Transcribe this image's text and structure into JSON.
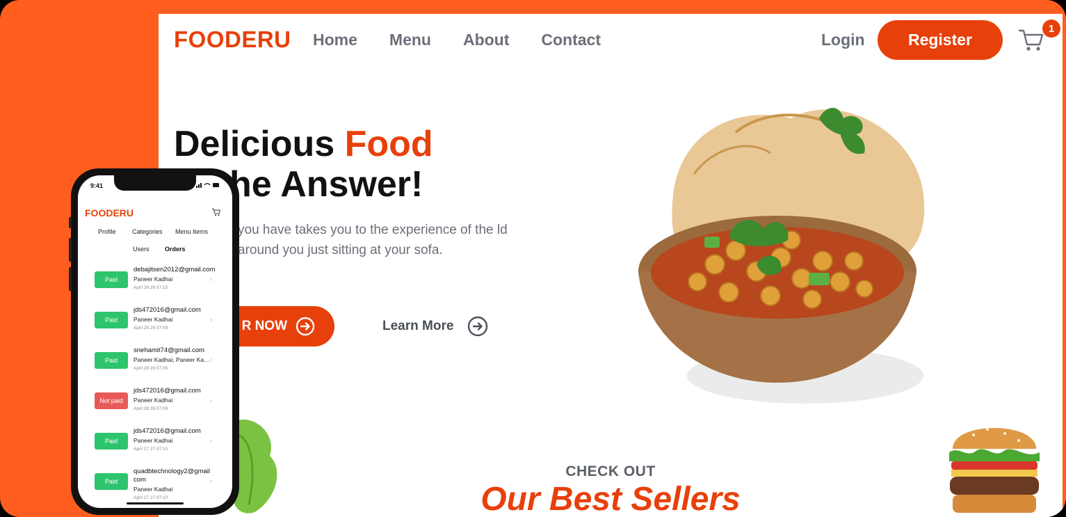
{
  "website": {
    "brand": "FOODERU",
    "nav": [
      "Home",
      "Menu",
      "About",
      "Contact"
    ],
    "login": "Login",
    "register": "Register",
    "cart_count": "1",
    "hero": {
      "title_part1": "Delicious ",
      "title_accent": "Food",
      "title_line2": "he Answer!",
      "description": "you have takes you to the experience of the ld around you just sitting at your sofa.",
      "order_button": "R NOW",
      "learn_more": "Learn More"
    },
    "section_kicker": "CHECK OUT",
    "section_title": "Our Best Sellers"
  },
  "phone": {
    "time": "9:41",
    "brand": "FOODERU",
    "tabs": [
      "Profile",
      "Categories",
      "Menu Items",
      "Users",
      "Orders"
    ],
    "active_tab": "Orders",
    "orders": [
      {
        "status": "Paid",
        "email": "debajitsen2012@gmail.com",
        "items": "Paneer Kadhai",
        "date": "April 28 28 07:15"
      },
      {
        "status": "Paid",
        "email": "jds472016@gmail.com",
        "items": "Paneer Kadhai",
        "date": "April 28 28 07:09"
      },
      {
        "status": "Paid",
        "email": "snehamit74@gmail.com",
        "items": "Paneer Kadhai, Paneer Kadhai",
        "date": "April 28 28 07:09"
      },
      {
        "status": "Not paid",
        "email": "jds472016@gmail.com",
        "items": "Paneer Kadhai",
        "date": "April 28 28 07:09"
      },
      {
        "status": "Paid",
        "email": "jds472016@gmail.com",
        "items": "Paneer Kadhai",
        "date": "April 27 27 07:10"
      },
      {
        "status": "Paid",
        "email": "quadbtechnology2@gmail com",
        "items": "Paneer Kadhai",
        "date": "April 27 27 07:10"
      }
    ]
  },
  "colors": {
    "accent": "#E8400B",
    "background_orange": "#FF5E1F",
    "paid": "#2EC46E",
    "not_paid": "#E85A57",
    "nav_text": "#6B6F78"
  }
}
